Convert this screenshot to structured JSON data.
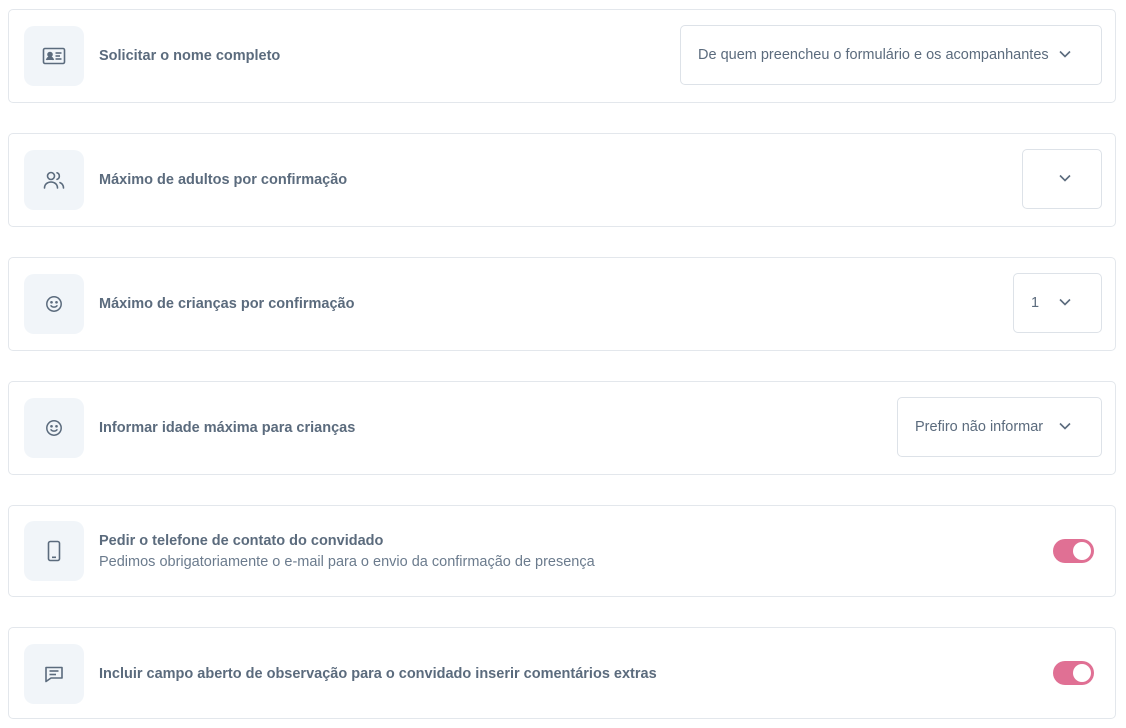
{
  "settings": [
    {
      "icon": "id-card-icon",
      "label": "Solicitar o nome completo",
      "control": "select",
      "value": "De quem preencheu o formulário e os acompanhantes"
    },
    {
      "icon": "users-icon",
      "label": "Máximo de adultos por confirmação",
      "control": "select",
      "value": ""
    },
    {
      "icon": "smiley-icon",
      "label": "Máximo de crianças por confirmação",
      "control": "select",
      "value": "1"
    },
    {
      "icon": "smiley-icon",
      "label": "Informar idade máxima para crianças",
      "control": "select",
      "value": "Prefiro não informar"
    },
    {
      "icon": "phone-icon",
      "label": "Pedir o telefone de contato do convidado",
      "description": "Pedimos obrigatoriamente o e-mail para o envio da confirmação de presença",
      "control": "toggle",
      "on": true
    },
    {
      "icon": "message-lines-icon",
      "label": "Incluir campo aberto de observação para o convidado inserir comentários extras",
      "control": "toggle",
      "on": true
    }
  ],
  "colors": {
    "toggle_on": "#e07094",
    "icon_bg": "#f1f5f9",
    "text": "#5b6b7d"
  }
}
